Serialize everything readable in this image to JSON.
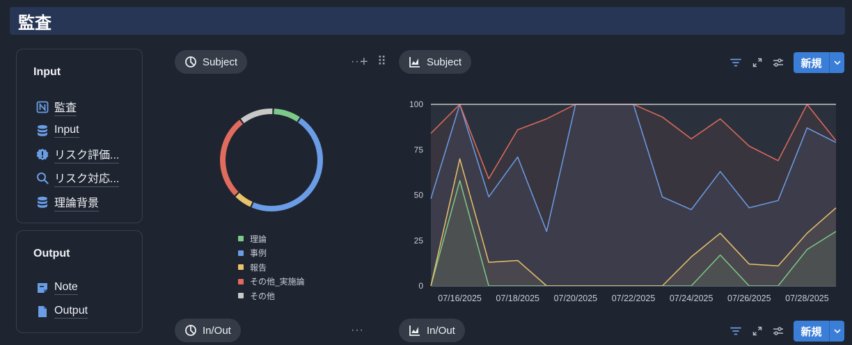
{
  "page": {
    "title": "監査"
  },
  "input_card": {
    "title": "Input",
    "items": [
      {
        "label": "監査",
        "icon": "notion-icon"
      },
      {
        "label": "Input",
        "icon": "database-icon"
      },
      {
        "label": "リスク評価...",
        "icon": "alert-icon"
      },
      {
        "label": "リスク対応...",
        "icon": "search-icon"
      },
      {
        "label": "理論背景",
        "icon": "database-icon"
      }
    ]
  },
  "output_card": {
    "title": "Output",
    "items": [
      {
        "label": "Note",
        "icon": "note-icon"
      },
      {
        "label": "Output",
        "icon": "file-icon"
      }
    ]
  },
  "views": {
    "top_left": {
      "label": "Subject",
      "icon": "pie-chart-icon"
    },
    "top_right": {
      "label": "Subject",
      "icon": "line-chart-icon"
    },
    "bottom_left": {
      "label": "In/Out",
      "icon": "pie-chart-icon"
    },
    "bottom_right": {
      "label": "In/Out",
      "icon": "line-chart-icon"
    }
  },
  "toolbar": {
    "new_label": "新規",
    "more_label": "···",
    "add_label": "+",
    "drag_label": "⠿"
  },
  "colors": {
    "green": "#7cc98a",
    "blue": "#6b9de6",
    "yellow": "#e8c36a",
    "red": "#e16c5d",
    "gray": "#c8c8c8",
    "accent": "#3b7ed8"
  },
  "chart_data": [
    {
      "type": "pie",
      "style": "donut",
      "legend_position": "bottom",
      "categories": [
        "理論",
        "事例",
        "報告",
        "その他_実施論",
        "その他"
      ],
      "values": [
        9,
        47,
        6,
        27,
        11
      ],
      "colors": [
        "#7cc98a",
        "#6b9de6",
        "#e8c36a",
        "#e16c5d",
        "#c8c8c8"
      ]
    },
    {
      "type": "line",
      "style": "stacked-100-area",
      "x": [
        "07/15/2025",
        "07/16/2025",
        "07/17/2025",
        "07/18/2025",
        "07/19/2025",
        "07/20/2025",
        "07/21/2025",
        "07/22/2025",
        "07/23/2025",
        "07/24/2025",
        "07/25/2025",
        "07/26/2025",
        "07/27/2025",
        "07/28/2025",
        "07/29/2025"
      ],
      "x_tick_labels": [
        "07/16/2025",
        "07/18/2025",
        "07/20/2025",
        "07/22/2025",
        "07/24/2025",
        "07/26/2025",
        "07/28/2025"
      ],
      "ylim": [
        0,
        100
      ],
      "y_ticks": [
        0,
        25,
        50,
        75,
        100
      ],
      "grid": false,
      "series": [
        {
          "values": [
            0,
            58,
            0,
            0,
            0,
            0,
            0,
            0,
            0,
            0,
            17,
            0,
            0,
            20,
            30
          ],
          "color": "#7cc98a"
        },
        {
          "values": [
            0,
            70,
            13,
            14,
            0,
            0,
            0,
            0,
            0,
            16,
            29,
            12,
            11,
            29,
            43
          ],
          "color": "#e8c36a"
        },
        {
          "values": [
            48,
            100,
            49,
            71,
            30,
            100,
            100,
            100,
            49,
            42,
            63,
            43,
            47,
            87,
            79
          ],
          "color": "#6b9de6"
        },
        {
          "values": [
            84,
            100,
            59,
            86,
            92,
            100,
            100,
            100,
            93,
            81,
            92,
            77,
            69,
            100,
            80
          ],
          "color": "#e16c5d"
        },
        {
          "values": [
            100,
            100,
            100,
            100,
            100,
            100,
            100,
            100,
            100,
            100,
            100,
            100,
            100,
            100,
            100
          ],
          "color": "#c8c8c8"
        }
      ]
    }
  ]
}
